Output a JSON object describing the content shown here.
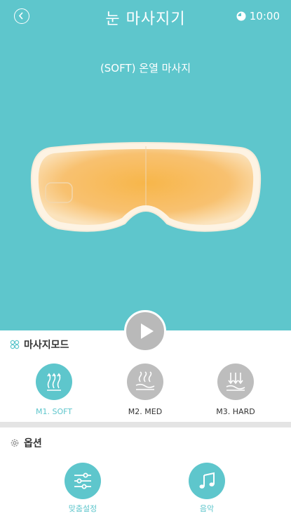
{
  "header": {
    "title": "눈 마사지기",
    "time": "10:00"
  },
  "hero": {
    "mode_title": "(SOFT) 온열 마사지"
  },
  "massage_mode": {
    "heading": "마사지모드",
    "items": [
      {
        "label": "M1. SOFT",
        "icon": "heat-waves-icon",
        "active": true
      },
      {
        "label": "M2. MED",
        "icon": "heat-hand-icon",
        "active": false
      },
      {
        "label": "M3. HARD",
        "icon": "press-down-icon",
        "active": false
      }
    ]
  },
  "options": {
    "heading": "옵션",
    "items": [
      {
        "label": "맞춤설정",
        "icon": "sliders-icon"
      },
      {
        "label": "음악",
        "icon": "music-note-icon"
      }
    ]
  },
  "colors": {
    "accent": "#5ec6cc",
    "inactive": "#bdbdbd",
    "mask_glow": "#f7b64a"
  }
}
